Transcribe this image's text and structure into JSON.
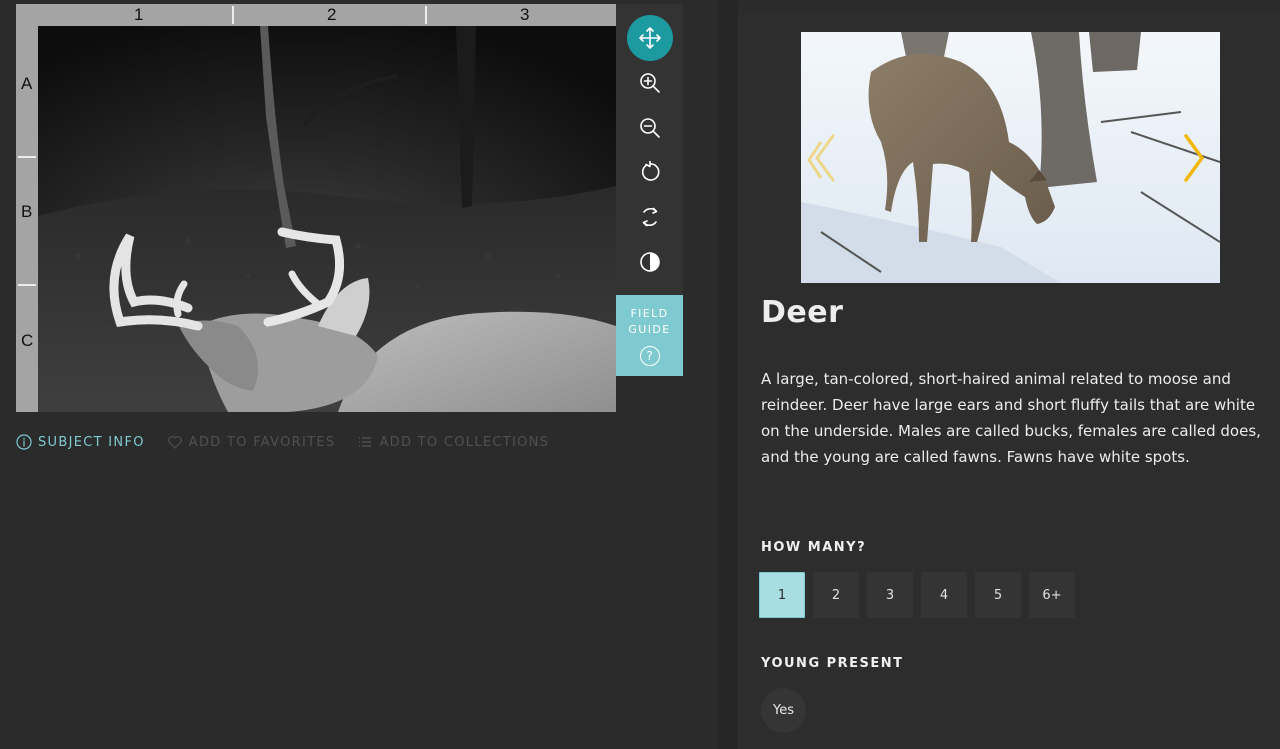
{
  "viewer": {
    "ruler_columns": [
      "1",
      "2",
      "3"
    ],
    "ruler_rows": [
      "A",
      "B",
      "C"
    ]
  },
  "toolbar": {
    "tools": [
      {
        "name": "move-icon",
        "active": true
      },
      {
        "name": "zoom-in-icon",
        "active": false
      },
      {
        "name": "zoom-out-icon",
        "active": false
      },
      {
        "name": "rotate-icon",
        "active": false
      },
      {
        "name": "reset-icon",
        "active": false
      },
      {
        "name": "invert-icon",
        "active": false
      }
    ],
    "field_guide_label": "FIELD GUIDE",
    "field_guide_icon": "?"
  },
  "meta": {
    "subject_info": "SUBJECT INFO",
    "add_favorites": "ADD TO FAVORITES",
    "add_collections": "ADD TO COLLECTIONS",
    "active_color": "#7fcad0",
    "inactive_color": "#505050"
  },
  "species": {
    "name": "Deer",
    "description": "A large, tan-colored, short-haired animal related to moose and reindeer. Deer have large ears and short fluffy tails that are white on the underside. Males are called bucks, females are called does, and the young are called fawns. Fawns have white spots."
  },
  "questions": {
    "how_many": {
      "title": "HOW MANY?",
      "options": [
        "1",
        "2",
        "3",
        "4",
        "5",
        "6+"
      ],
      "selected": "1"
    },
    "young_present": {
      "title": "YOUNG PRESENT",
      "option": "Yes"
    }
  },
  "colors": {
    "accent": "#1c9aa0",
    "field_guide_bg": "#7fcad0",
    "selected_count": "#a8dde2",
    "carousel_arrow": "#f2b705"
  }
}
